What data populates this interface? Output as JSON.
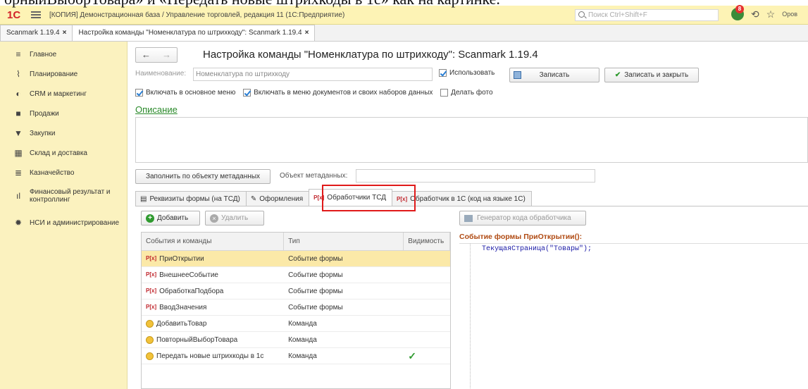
{
  "overlay_text": "орныйВыборТовара» и «Передать новые штрихкоды в 1с» как на картинке.",
  "titlebar": {
    "logo": "1С",
    "title": "[КОПИЯ] Демонстрационная база / Управление торговлей, редакция 11  (1С:Предприятие)",
    "search_placeholder": "Поиск Ctrl+Shift+F",
    "notification_count": "8",
    "user": "Оров"
  },
  "doc_tabs": [
    {
      "label": "Scanmark 1.19.4"
    },
    {
      "label": "Настройка команды \"Номенклатура по штрихкоду\": Scanmark 1.19.4"
    }
  ],
  "sidebar": {
    "items": [
      {
        "label": "Главное",
        "icon": "menu-icon"
      },
      {
        "label": "Планирование",
        "icon": "chart-icon"
      },
      {
        "label": "CRM и маркетинг",
        "icon": "crm-icon"
      },
      {
        "label": "Продажи",
        "icon": "bag-icon"
      },
      {
        "label": "Закупки",
        "icon": "cart-icon"
      },
      {
        "label": "Склад и доставка",
        "icon": "warehouse-icon"
      },
      {
        "label": "Казначейство",
        "icon": "treasury-icon"
      },
      {
        "label": "Финансовый результат и контроллинг",
        "icon": "finance-icon"
      },
      {
        "label": "НСИ и администрирование",
        "icon": "gear-icon"
      }
    ]
  },
  "form": {
    "title": "Настройка команды \"Номенклатура по штрихкоду\": Scanmark 1.19.4",
    "name_label": "Наименование:",
    "name_value": "Номенклатура по штрихкоду",
    "use_label": "Использовать",
    "save_label": "Записать",
    "save_close_label": "Записать и закрыть",
    "cb_main_menu": "Включать в основное меню",
    "cb_doc_menu": "Включать в меню документов и своих наборов данных",
    "cb_photo": "Делать фото",
    "description_link": "Описание",
    "fill_button": "Заполнить по объекту метаданных",
    "meta_label": "Объект метаданных:",
    "tabs": [
      {
        "label": "Реквизиты формы (на ТСД)"
      },
      {
        "label": "Оформления"
      },
      {
        "label": "Обработчики ТСД"
      },
      {
        "label": "Обработчик в 1С  (код на языке 1С)"
      }
    ],
    "add_label": "Добавить",
    "delete_label": "Удалить",
    "generator_label": "Генератор кода обработчика",
    "grid": {
      "headers": [
        "События и команды",
        "Тип",
        "Видимость"
      ],
      "rows": [
        {
          "name": "ПриОткрытии",
          "type": "Событие формы",
          "kind": "event",
          "visible": ""
        },
        {
          "name": "ВнешнееСобытие",
          "type": "Событие формы",
          "kind": "event",
          "visible": ""
        },
        {
          "name": "ОбработкаПодбора",
          "type": "Событие формы",
          "kind": "event",
          "visible": ""
        },
        {
          "name": "ВводЗначения",
          "type": "Событие формы",
          "kind": "event",
          "visible": ""
        },
        {
          "name": "ДобавитьТовар",
          "type": "Команда",
          "kind": "command",
          "visible": ""
        },
        {
          "name": "ПовторныйВыборТовара",
          "type": "Команда",
          "kind": "command",
          "visible": ""
        },
        {
          "name": "Передать новые штрихкоды в 1с",
          "type": "Команда",
          "kind": "command",
          "visible": "✓"
        }
      ]
    },
    "code_title": "Событие формы ПриОткрытии():",
    "code_line": "ТекущаяСтраница(\"Товары\");"
  }
}
